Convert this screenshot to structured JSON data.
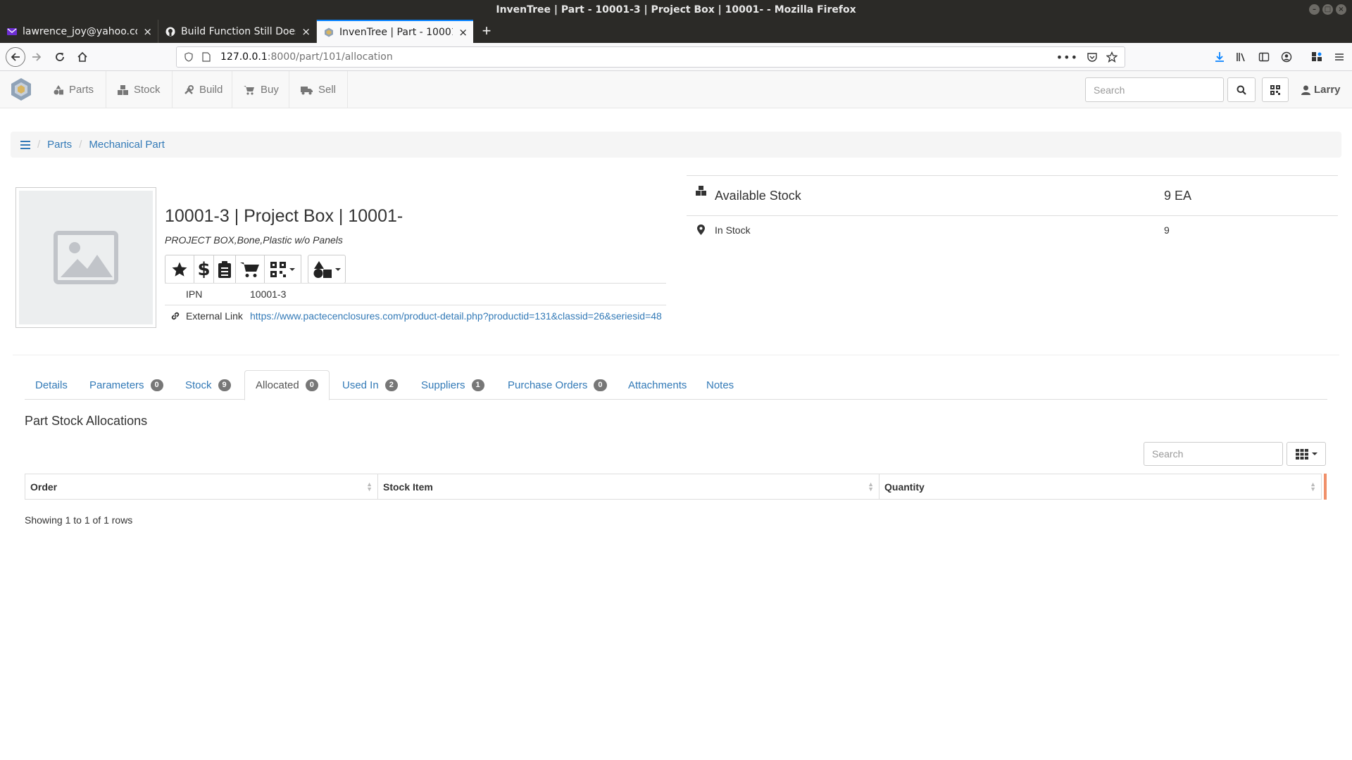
{
  "window": {
    "title": "InvenTree | Part - 10001-3 | Project Box | 10001- - Mozilla Firefox"
  },
  "tabs": [
    {
      "label": "lawrence_joy@yahoo.co",
      "icon": "yahoo-mail-icon",
      "active": false
    },
    {
      "label": "Build Function Still Does",
      "icon": "github-icon",
      "active": false
    },
    {
      "label": "InvenTree | Part - 10001-",
      "icon": "inventree-icon",
      "active": true
    }
  ],
  "url": {
    "host": "127.0.0.1",
    "path": ":8000/part/101/allocation"
  },
  "app": {
    "nav": [
      {
        "label": "Parts",
        "icon": "shapes-icon"
      },
      {
        "label": "Stock",
        "icon": "boxes-icon"
      },
      {
        "label": "Build",
        "icon": "tools-icon"
      },
      {
        "label": "Buy",
        "icon": "shopping-cart-icon"
      },
      {
        "label": "Sell",
        "icon": "truck-icon"
      }
    ],
    "search_placeholder": "Search",
    "user": "Larry"
  },
  "breadcrumb": [
    "Parts",
    "Mechanical Part"
  ],
  "part": {
    "title": "10001-3 | Project Box | 10001-",
    "description": "PROJECT BOX,Bone,Plastic w/o Panels",
    "ipn_label": "IPN",
    "ipn": "10001-3",
    "link_label": "External Link",
    "link": "https://www.pactecenclosures.com/product-detail.php?productid=131&classid=26&seriesid=48"
  },
  "stock": {
    "available_label": "Available Stock",
    "available_value": "9 EA",
    "in_stock_label": "In Stock",
    "in_stock_value": "9"
  },
  "part_tabs": [
    {
      "label": "Details",
      "badge": null,
      "active": false
    },
    {
      "label": "Parameters",
      "badge": "0",
      "active": false
    },
    {
      "label": "Stock",
      "badge": "9",
      "active": false
    },
    {
      "label": "Allocated",
      "badge": "0",
      "active": true
    },
    {
      "label": "Used In",
      "badge": "2",
      "active": false
    },
    {
      "label": "Suppliers",
      "badge": "1",
      "active": false
    },
    {
      "label": "Purchase Orders",
      "badge": "0",
      "active": false
    },
    {
      "label": "Attachments",
      "badge": null,
      "active": false
    },
    {
      "label": "Notes",
      "badge": null,
      "active": false
    }
  ],
  "allocations": {
    "title": "Part Stock Allocations",
    "search_placeholder": "Search",
    "columns": [
      "Order",
      "Stock Item",
      "Quantity"
    ],
    "footer": "Showing 1 to 1 of 1 rows"
  },
  "colors": {
    "link": "#337ab7",
    "badge": "#777777",
    "firefox_dark": "#2b2a27",
    "accent": "#0a84ff"
  }
}
